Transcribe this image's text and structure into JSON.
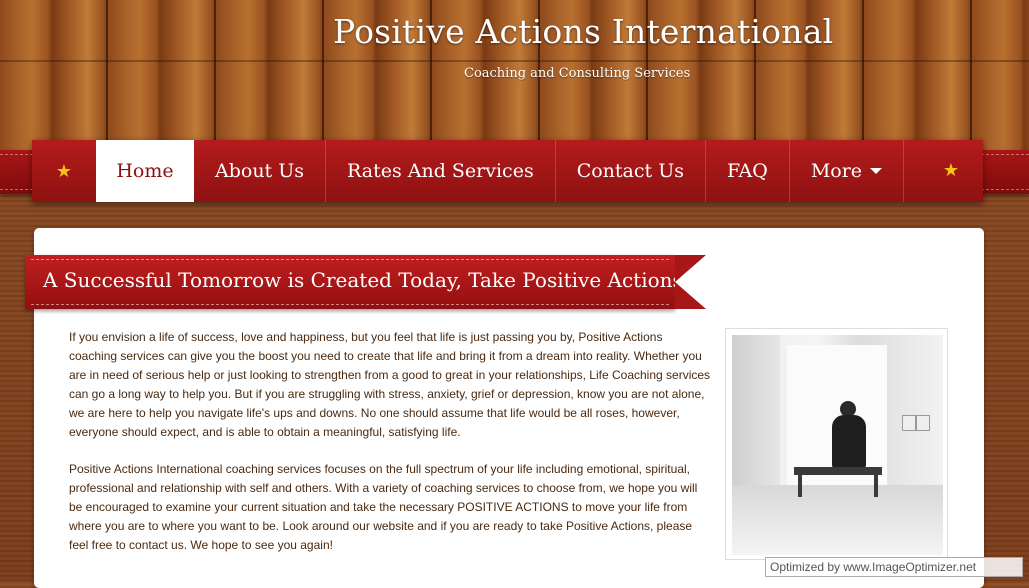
{
  "header": {
    "title": "Positive Actions International",
    "subtitle": "Coaching and Consulting Services"
  },
  "nav": {
    "items": [
      {
        "label": "Home",
        "active": true
      },
      {
        "label": "About Us"
      },
      {
        "label": "Rates And Services"
      },
      {
        "label": "Contact Us"
      },
      {
        "label": "FAQ"
      },
      {
        "label": "More"
      }
    ],
    "star_left": "★",
    "star_right": "★"
  },
  "banner": {
    "heading": "A Successful Tomorrow is Created Today, Take Positive Actions."
  },
  "content": {
    "paragraph_1": "If you envision a life of success, love and happiness, but you feel that life is just passing you by, Positive Actions coaching services can give you the boost you need to create that life and bring it from a dream into reality.   Whether you are in need of serious help or just looking to strengthen from a good to great in your relationships, Life Coaching services can go a long way to help you. But if you are struggling with stress, anxiety, grief or depression, know you are not alone, we are here to help you navigate life's ups and downs. No one should assume that life would be all roses, however, everyone should expect, and is able to obtain a meaningful, satisfying life.",
    "paragraph_2": "Positive Actions International coaching services focuses on the full spectrum of your life including emotional, spiritual, professional and relationship with self and others.  With a variety of coaching services to choose from, we hope you will be encouraged to examine your current situation and take the necessary POSITIVE ACTIONS to move your life from where you are to where you want to be.  Look around our website and if you are ready to take Positive Actions, please feel free to contact us.  We hope to see you again!"
  },
  "watermark": "Optimized by www.ImageOptimizer.net",
  "colors": {
    "nav_red": "#a81616",
    "star_gold": "#f6c418",
    "active_text": "#8b1010",
    "body_text": "#4a2a10"
  }
}
